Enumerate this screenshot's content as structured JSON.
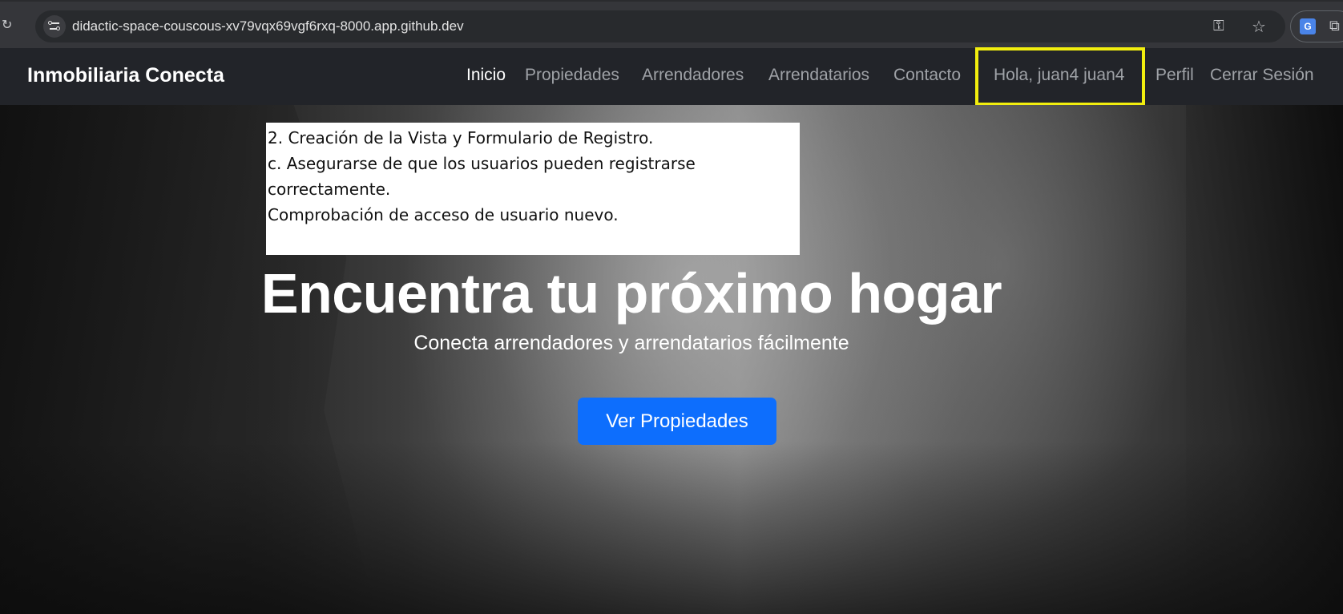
{
  "browser": {
    "url": "didactic-space-couscous-xv79vqx69vgf6rxq-8000.app.github.dev",
    "icons": [
      "reload-icon",
      "site-info-icon",
      "key-icon",
      "star-icon",
      "translate-icon",
      "puzzle-icon"
    ],
    "translate_glyph": "G"
  },
  "navbar": {
    "brand": "Inmobiliaria Conecta",
    "links": [
      {
        "label": "Inicio",
        "active": true
      },
      {
        "label": "Propiedades"
      },
      {
        "label": "Arrendadores"
      },
      {
        "label": "Arrendatarios"
      },
      {
        "label": "Contacto"
      },
      {
        "label": "Hola, juan4 juan4"
      },
      {
        "label": "Perfil"
      },
      {
        "label": "Cerrar Sesión"
      }
    ],
    "highlight_color": "#f2ee0e"
  },
  "note": {
    "lines": [
      "2. Creación de la Vista y Formulario de Registro.",
      "c. Asegurarse de que los usuarios pueden registrarse",
      "correctamente.",
      "Comprobación de acceso de usuario nuevo."
    ]
  },
  "hero": {
    "title": "Encuentra tu próximo hogar",
    "subtitle": "Conecta arrendadores y arrendatarios fácilmente",
    "button_label": "Ver Propiedades",
    "button_color": "#0d6efd"
  }
}
